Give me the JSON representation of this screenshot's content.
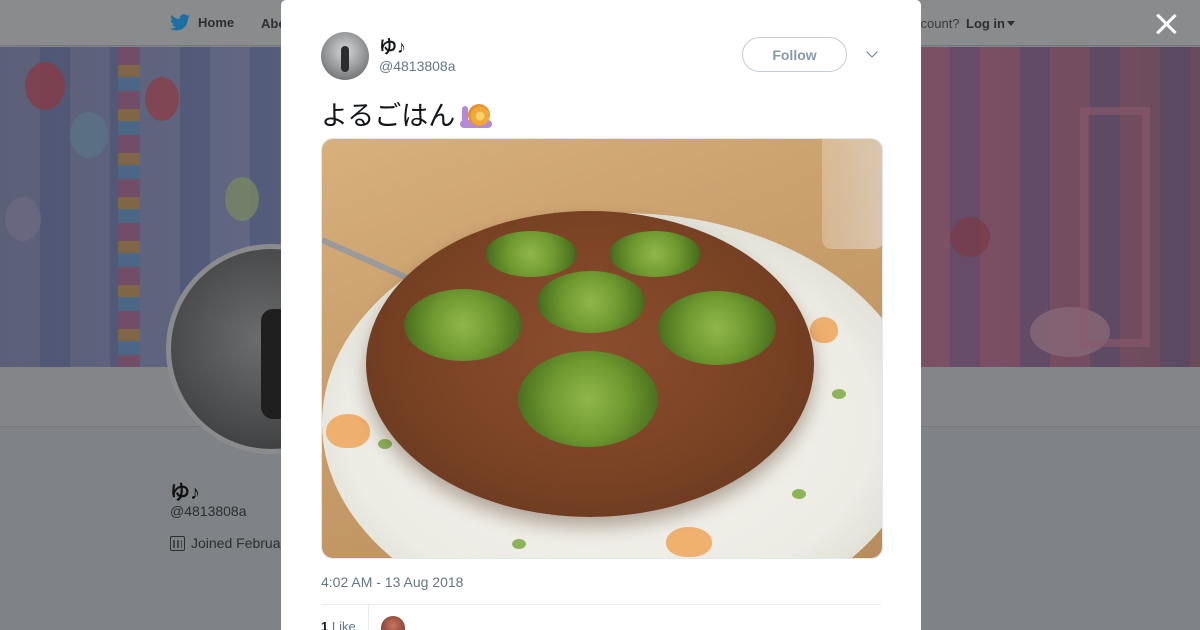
{
  "nav": {
    "home_label": "Home",
    "about_label": "Abo",
    "account_prompt": "ccount?",
    "login_label": "Log in"
  },
  "profile": {
    "name": "ゆ♪",
    "handle": "@4813808a",
    "joined": "Joined Februa"
  },
  "tweet": {
    "author_name": "ゆ♪",
    "author_handle": "@4813808a",
    "follow_label": "Follow",
    "text": "よるごはん",
    "emoji_icon": "snail-icon",
    "timestamp": "4:02 AM - 13 Aug 2018",
    "like_count": "1",
    "like_label": "Like"
  },
  "colors": {
    "twitter_blue": "#1da1f2",
    "overlay": "#7f8287",
    "text_primary": "#14171a",
    "text_secondary": "#657786"
  }
}
